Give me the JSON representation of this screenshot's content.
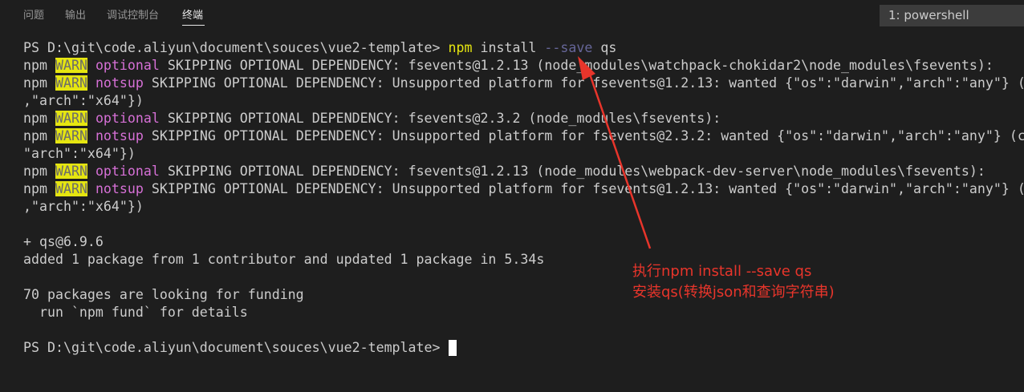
{
  "panel": {
    "tabs": [
      {
        "label": "问题"
      },
      {
        "label": "输出"
      },
      {
        "label": "调试控制台"
      },
      {
        "label": "终端",
        "active": true
      }
    ],
    "terminal_selector": "1: powershell"
  },
  "terminal": {
    "prompt_path": "PS D:\\git\\code.aliyun\\document\\souces\\vue2-template> ",
    "command": {
      "program": "npm",
      "arg1": "install",
      "flag": "--save",
      "arg2": "qs"
    },
    "warn_prefix": "npm ",
    "warn_badge": "WARN",
    "warnings": [
      {
        "type": "optional",
        "text": " SKIPPING OPTIONAL DEPENDENCY: fsevents@1.2.13 (node_modules\\watchpack-chokidar2\\node_modules\\fsevents):"
      },
      {
        "type": "notsup",
        "text": " SKIPPING OPTIONAL DEPENDENCY: Unsupported platform for fsevents@1.2.13: wanted {\"os\":\"darwin\",\"arch\":\"any\"} (c"
      },
      {
        "type": "optional",
        "text": " SKIPPING OPTIONAL DEPENDENCY: fsevents@2.3.2 (node_modules\\fsevents):"
      },
      {
        "type": "notsup",
        "text": " SKIPPING OPTIONAL DEPENDENCY: Unsupported platform for fsevents@2.3.2: wanted {\"os\":\"darwin\",\"arch\":\"any\"} (c"
      },
      {
        "type": "optional",
        "text": " SKIPPING OPTIONAL DEPENDENCY: fsevents@1.2.13 (node_modules\\webpack-dev-server\\node_modules\\fsevents):"
      },
      {
        "type": "notsup",
        "text": " SKIPPING OPTIONAL DEPENDENCY: Unsupported platform for fsevents@1.2.13: wanted {\"os\":\"darwin\",\"arch\":\"any\"} (c"
      }
    ],
    "wrap_lines": [
      ",\"arch\":\"x64\"})",
      "\"arch\":\"x64\"})",
      ",\"arch\":\"x64\"})"
    ],
    "result_lines": [
      "+ qs@6.9.6",
      "added 1 package from 1 contributor and updated 1 package in 5.34s",
      "70 packages are looking for funding",
      "  run `npm fund` for details"
    ],
    "final_prompt": "PS D:\\git\\code.aliyun\\document\\souces\\vue2-template> "
  },
  "annotation": {
    "line1": "执行npm install --save qs",
    "line2": "安装qs(转换json和查询字符串)",
    "color": "#e8352b"
  }
}
